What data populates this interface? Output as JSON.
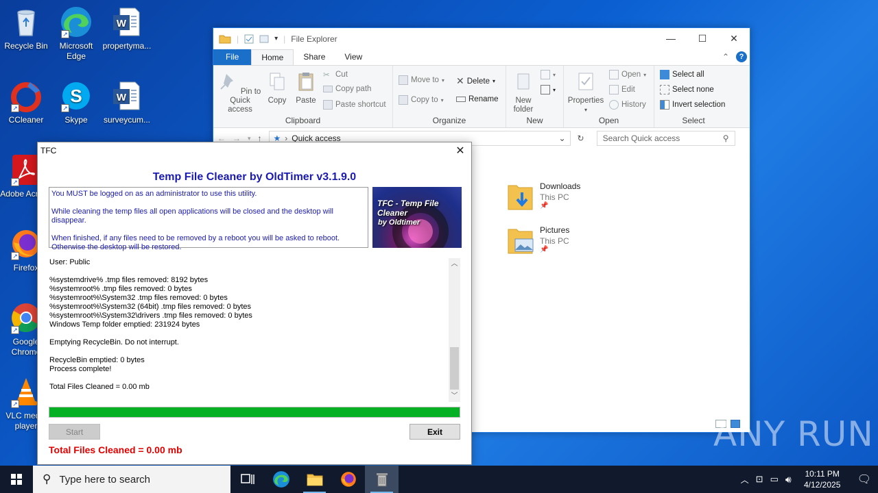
{
  "desktop": {
    "icons": [
      {
        "label": "Recycle Bin",
        "icon": "recycle-bin-icon"
      },
      {
        "label": "Microsoft Edge",
        "icon": "edge-icon"
      },
      {
        "label": "propertyma...",
        "icon": "word-document-icon"
      },
      {
        "label": "CCleaner",
        "icon": "ccleaner-icon"
      },
      {
        "label": "Skype",
        "icon": "skype-icon"
      },
      {
        "label": "surveycum...",
        "icon": "word-document-icon"
      },
      {
        "label": "Adobe Acroba",
        "icon": "acrobat-icon"
      },
      {
        "label": "Firefox",
        "icon": "firefox-icon"
      },
      {
        "label": "Google Chrome",
        "icon": "chrome-icon"
      },
      {
        "label": "VLC media player",
        "icon": "vlc-icon"
      }
    ]
  },
  "explorer": {
    "title": "File Explorer",
    "tabs": [
      "File",
      "Home",
      "Share",
      "View"
    ],
    "ribbon": {
      "clipboard": {
        "title": "Clipboard",
        "pin": "Pin to Quick access",
        "copy": "Copy",
        "paste": "Paste",
        "cut": "Cut",
        "copy_path": "Copy path",
        "paste_shortcut": "Paste shortcut"
      },
      "organize": {
        "title": "Organize",
        "move_to": "Move to",
        "copy_to": "Copy to",
        "delete": "Delete",
        "rename": "Rename"
      },
      "new": {
        "title": "New",
        "new_folder": "New folder"
      },
      "open": {
        "title": "Open",
        "properties": "Properties",
        "open": "Open",
        "edit": "Edit",
        "history": "History"
      },
      "select": {
        "title": "Select",
        "select_all": "Select all",
        "select_none": "Select none",
        "invert": "Invert selection"
      }
    },
    "address": "Quick access",
    "search_placeholder": "Search Quick access",
    "items": [
      {
        "name": "Downloads",
        "location": "This PC"
      },
      {
        "name": "Pictures",
        "location": "This PC"
      }
    ]
  },
  "tfc": {
    "window_title": "TFC",
    "heading": "Temp File Cleaner by OldTimer v3.1.9.0",
    "info_line1": "You MUST be logged on as an administrator to use this utility.",
    "info_line2": "While cleaning the temp files all open applications will be closed and the desktop will disappear.",
    "info_line3": "When finished, if any files need to be removed by a reboot you will be asked to reboot.",
    "info_line4": "Otherwise the desktop will be restored.",
    "logo_line1": "TFC - Temp File Cleaner",
    "logo_line2": "by Oldtimer",
    "log_lines": [
      "User: Public",
      "",
      "%systemdrive% .tmp files removed: 8192 bytes",
      "%systemroot% .tmp files removed: 0 bytes",
      "%systemroot%\\System32 .tmp files removed: 0 bytes",
      "%systemroot%\\System32 (64bit) .tmp files removed: 0 bytes",
      "%systemroot%\\System32\\drivers .tmp files removed: 0 bytes",
      "Windows Temp folder emptied: 231924 bytes",
      "",
      "Emptying RecycleBin. Do not interrupt.",
      "",
      "RecycleBin emptied: 0 bytes",
      "Process complete!",
      "",
      "Total Files Cleaned = 0.00 mb"
    ],
    "progress_percent": 100,
    "start_label": "Start",
    "exit_label": "Exit",
    "total": "Total Files Cleaned = 0.00 mb"
  },
  "watermark": "ANY RUN",
  "taskbar": {
    "search_placeholder": "Type here to search",
    "time": "10:11 PM",
    "date": "4/12/2025"
  }
}
